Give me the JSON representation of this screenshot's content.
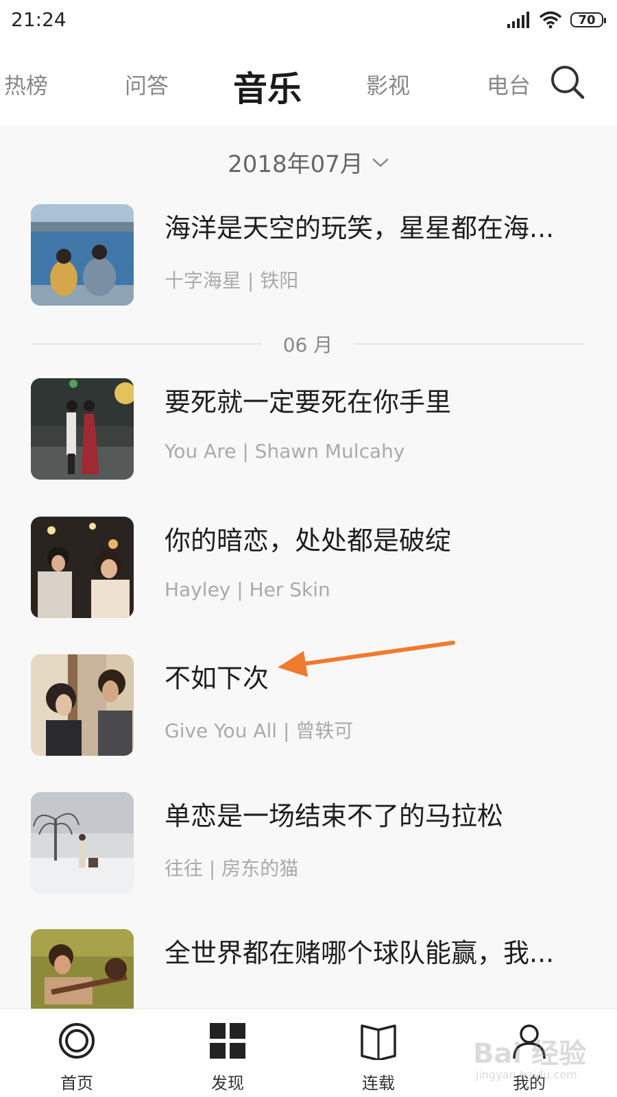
{
  "status_bar": {
    "time": "21:24",
    "battery": "70"
  },
  "top_tabs": [
    {
      "label": "热榜"
    },
    {
      "label": "问答"
    },
    {
      "label": "音乐"
    },
    {
      "label": "影视"
    },
    {
      "label": "电台"
    }
  ],
  "month_selector": {
    "label": "2018年07月"
  },
  "section_label": "06 月",
  "items": [
    {
      "title": "海洋是天空的玩笑，星星都在海...",
      "subtitle": "十字海星 | 铁阳"
    },
    {
      "title": "要死就一定要死在你手里",
      "subtitle": "You Are | Shawn Mulcahy"
    },
    {
      "title": "你的暗恋，处处都是破绽",
      "subtitle": "Hayley | Her Skin"
    },
    {
      "title": "不如下次",
      "subtitle": "Give You All | 曾轶可"
    },
    {
      "title": " 单恋是一场结束不了的马拉松",
      "subtitle": "往往 | 房东的猫"
    },
    {
      "title": "全世界都在赌哪个球队能赢，我...",
      "subtitle": ""
    }
  ],
  "bottom_nav": [
    {
      "label": "首页"
    },
    {
      "label": "发现"
    },
    {
      "label": "连载"
    },
    {
      "label": "我的"
    }
  ],
  "watermark": {
    "text": "Bai 经验",
    "sub": "jingyan.baidu.com"
  },
  "colors": {
    "arrow": "#f07a2e",
    "accent_text": "#1e1e1e",
    "muted_text": "#aaaaaa"
  }
}
